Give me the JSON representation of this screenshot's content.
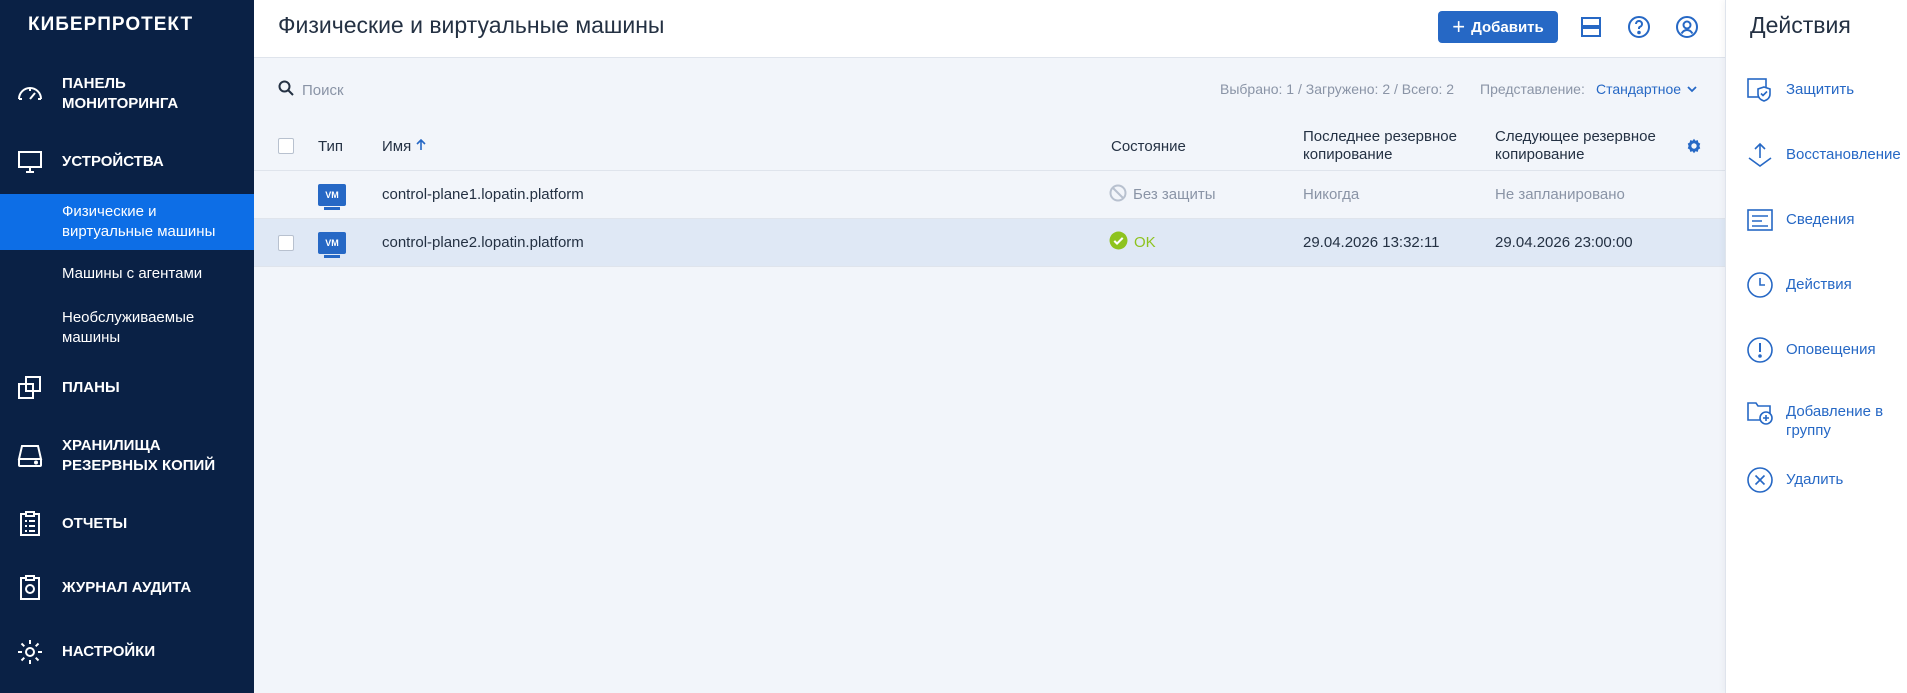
{
  "sidebar": {
    "logo": "КИБЕРПРОТЕКТ",
    "items": [
      {
        "label": "ПАНЕЛЬ МОНИТОРИНГА",
        "icon": "speedometer-icon"
      },
      {
        "label": "УСТРОЙСТВА",
        "icon": "monitor-icon"
      },
      {
        "label": "ПЛАНЫ",
        "icon": "plans-icon"
      },
      {
        "label": "ХРАНИЛИЩА РЕЗЕРВНЫХ КОПИЙ",
        "icon": "storage-icon"
      },
      {
        "label": "ОТЧЕТЫ",
        "icon": "clipboard-icon"
      },
      {
        "label": "ЖУРНАЛ АУДИТА",
        "icon": "audit-icon"
      },
      {
        "label": "НАСТРОЙКИ",
        "icon": "gear-icon"
      }
    ],
    "subitems": [
      {
        "label": "Физические и виртуальные машины",
        "active": true
      },
      {
        "label": "Машины с агентами"
      },
      {
        "label": "Необслуживаемые машины"
      }
    ]
  },
  "header": {
    "title": "Физические и виртуальные машины",
    "add_label": "Добавить"
  },
  "toolbar": {
    "search_placeholder": "Поиск",
    "counts": "Выбрано: 1 / Загружено: 2 / Всего: 2",
    "view_label": "Представление:",
    "view_value": "Стандартное"
  },
  "table": {
    "columns": {
      "type": "Тип",
      "name": "Имя",
      "status": "Состояние",
      "last_backup": "Последнее резервное копирование",
      "next_backup": "Следующее резервное копирование"
    },
    "rows": [
      {
        "type": "VM",
        "name": "control-plane1.lopatin.platform",
        "status": "Без защиты",
        "status_kind": "none",
        "last": "Никогда",
        "next": "Не запланировано",
        "selected": false
      },
      {
        "type": "VM",
        "name": "control-plane2.lopatin.platform",
        "status": "OK",
        "status_kind": "ok",
        "last": "29.04.2026 13:32:11",
        "next": "29.04.2026 23:00:00",
        "selected": true
      }
    ]
  },
  "panel": {
    "title": "Действия",
    "actions": [
      {
        "label": "Защитить",
        "icon": "shield-icon"
      },
      {
        "label": "Восстановление",
        "icon": "recovery-icon"
      },
      {
        "label": "Сведения",
        "icon": "details-icon"
      },
      {
        "label": "Действия",
        "icon": "clock-icon"
      },
      {
        "label": "Оповещения",
        "icon": "alert-icon"
      },
      {
        "label": "Добавление в группу",
        "icon": "folder-add-icon"
      },
      {
        "label": "Удалить",
        "icon": "delete-icon"
      }
    ]
  },
  "colors": {
    "sidebar_bg": "#0a2145",
    "accent": "#2668c5",
    "active_nav": "#0d6ee6",
    "ok": "#8ec31f",
    "selected_row": "#dfe8f5"
  }
}
